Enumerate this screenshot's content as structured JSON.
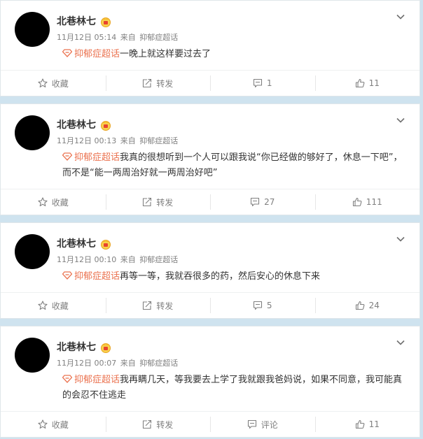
{
  "posts": [
    {
      "username": "北巷林七",
      "time": "11月12日 05:14",
      "via": "来自",
      "source": "抑郁症超话",
      "topic": "抑郁症超话",
      "text": "一晚上就这样要过去了",
      "fav_label": "收藏",
      "repost_label": "转发",
      "comment_count": "1",
      "like_count": "11"
    },
    {
      "username": "北巷林七",
      "time": "11月12日 00:13",
      "via": "来自",
      "source": "抑郁症超话",
      "topic": "抑郁症超话",
      "text": "我真的很想听到一个人可以跟我说“你已经做的够好了，休息一下吧”，而不是“能一两周治好就一两周治好吧”",
      "fav_label": "收藏",
      "repost_label": "转发",
      "comment_count": "27",
      "like_count": "111"
    },
    {
      "username": "北巷林七",
      "time": "11月12日 00:10",
      "via": "来自",
      "source": "抑郁症超话",
      "topic": "抑郁症超话",
      "text": "再等一等，我就吞很多的药，然后安心的休息下来",
      "fav_label": "收藏",
      "repost_label": "转发",
      "comment_count": "5",
      "like_count": "24"
    },
    {
      "username": "北巷林七",
      "time": "11月12日 00:07",
      "via": "来自",
      "source": "抑郁症超话",
      "topic": "抑郁症超话",
      "text": "我再瞒几天，等我要去上学了我就跟我爸妈说，如果不同意，我可能真的会忍不住逃走",
      "fav_label": "收藏",
      "repost_label": "转发",
      "comment_count": "评论",
      "like_count": "11"
    }
  ],
  "colors": {
    "topic": "#eb7350",
    "meta": "#808080",
    "background": "#cfe3ef"
  },
  "icons": {
    "vip": "vip-badge-icon",
    "topic": "supertopic-diamond-icon",
    "menu": "chevron-down-icon",
    "favorite": "star-icon",
    "repost": "repost-icon",
    "comment": "comment-icon",
    "like": "thumb-up-icon"
  }
}
